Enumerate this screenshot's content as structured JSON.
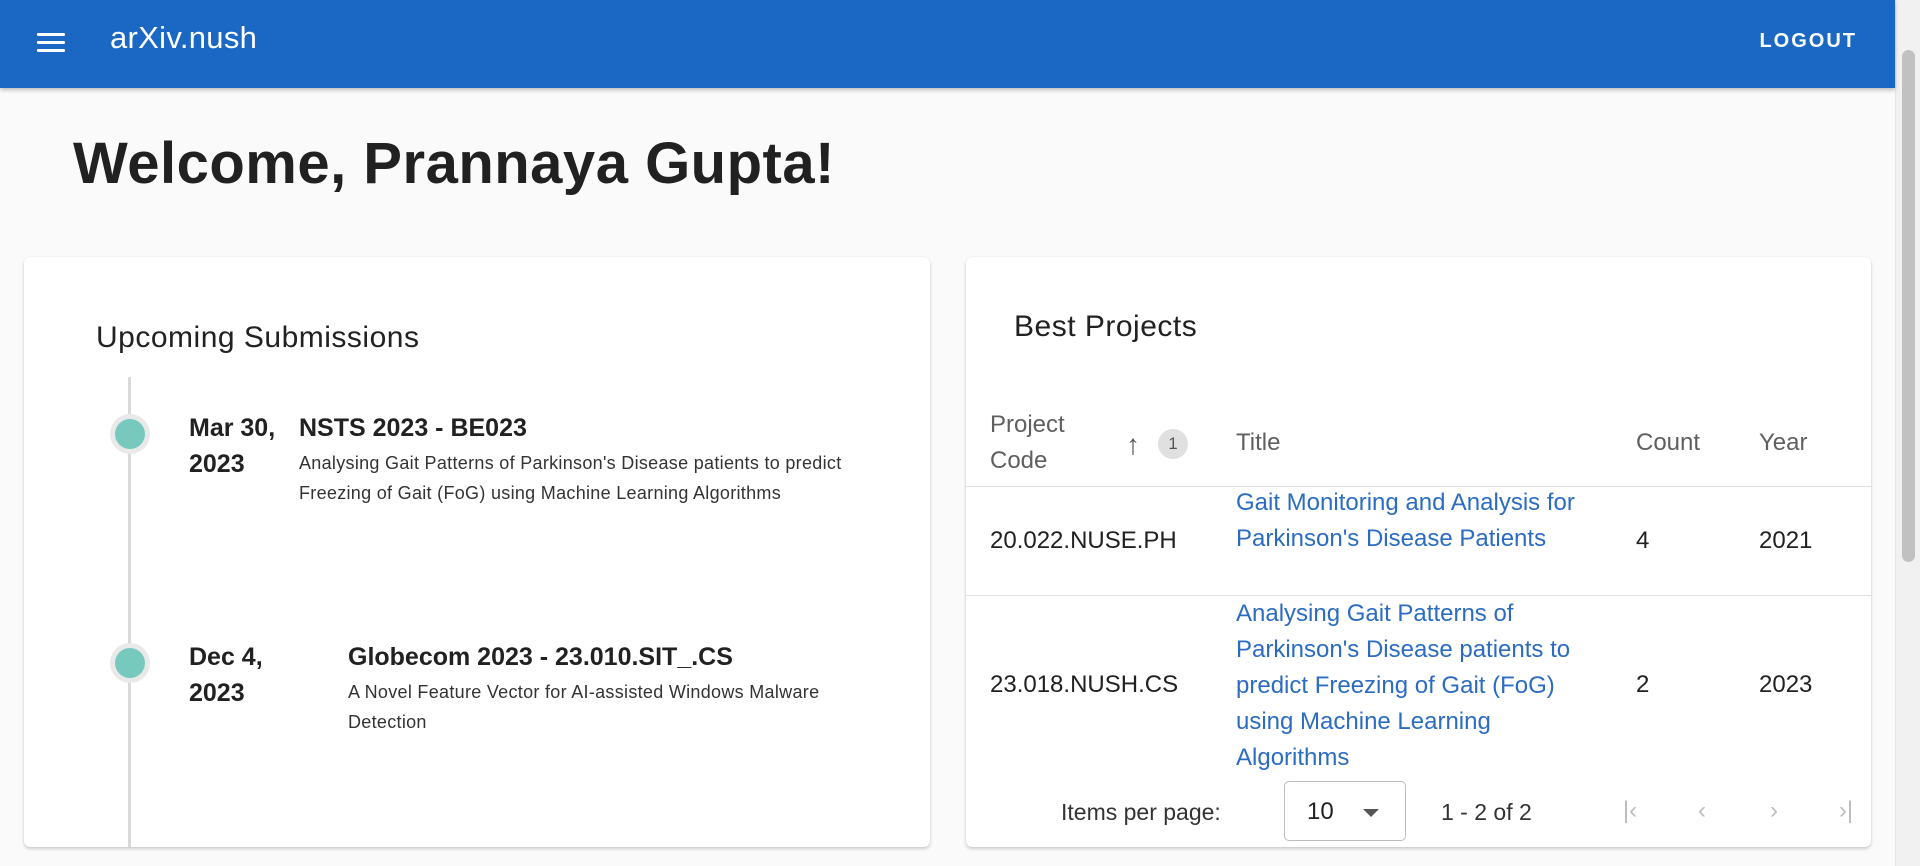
{
  "header": {
    "menu_icon": "hamburger-menu-icon",
    "app_title": "arXiv.nush",
    "logout_label": "LOGOUT",
    "color": "#1a67c4"
  },
  "welcome_text": "Welcome, Prannaya Gupta!",
  "upcoming": {
    "title": "Upcoming Submissions",
    "items": [
      {
        "date": "Mar 30, 2023",
        "name": "NSTS 2023 - BE023",
        "description": "Analysing Gait Patterns of Parkinson's Disease patients to predict Freezing of Gait (FoG) using Machine Learning Algorithms"
      },
      {
        "date": "Dec 4, 2023",
        "name": "Globecom 2023 - 23.010.SIT_.CS",
        "description": "A Novel Feature Vector for AI-assisted Windows Malware Detection"
      }
    ],
    "dot_color": "#77c9bd"
  },
  "best_projects": {
    "title": "Best Projects",
    "columns": {
      "code": "Project Code",
      "title": "Title",
      "count": "Count",
      "year": "Year"
    },
    "sort_icon": "arrow-up-icon",
    "sort_order": "1",
    "rows": [
      {
        "code": "20.022.NUSE.PH",
        "title": "Gait Monitoring and Analysis for Parkinson's Disease Patients",
        "count": "4",
        "year": "2021"
      },
      {
        "code": "23.018.NUSH.CS",
        "title": "Analysing Gait Patterns of Parkinson's Disease patients to predict Freezing of Gait (FoG) using Machine Learning Algorithms",
        "count": "2",
        "year": "2023"
      }
    ],
    "paginator": {
      "items_per_page_label": "Items per page:",
      "items_per_page_value": "10",
      "range_label": "1 - 2 of 2",
      "first_icon": "first-page-icon",
      "prev_icon": "chevron-left-icon",
      "next_icon": "chevron-right-icon",
      "last_icon": "last-page-icon"
    },
    "link_color": "#2b6cc2"
  }
}
